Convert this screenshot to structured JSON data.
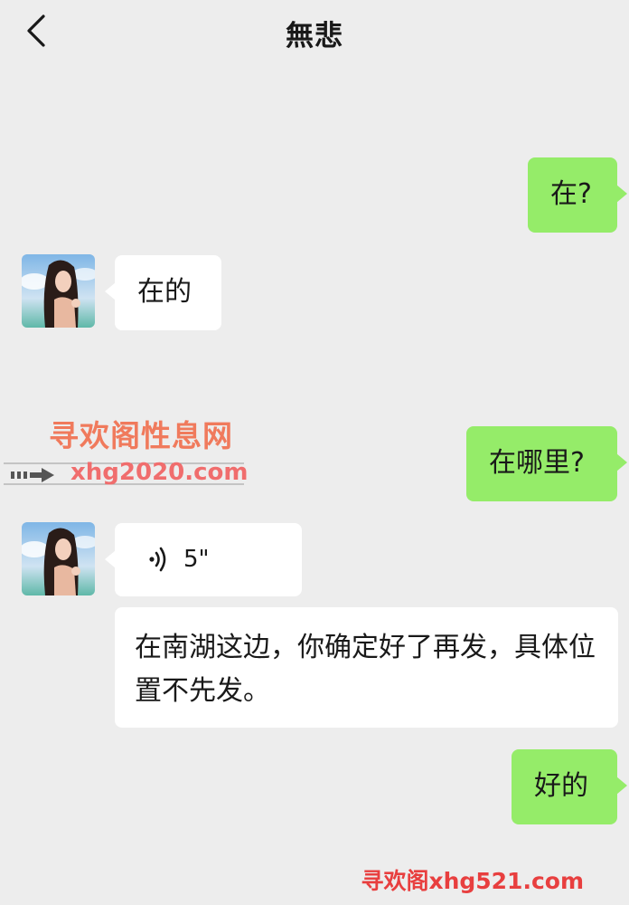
{
  "header": {
    "title": "無悲",
    "back_icon": "chevron-left-icon"
  },
  "messages": [
    {
      "side": "right",
      "text": "在?"
    },
    {
      "side": "left",
      "text": "在的"
    },
    {
      "side": "right",
      "text": "在哪里?"
    },
    {
      "side": "left",
      "type": "voice",
      "duration": "5\""
    },
    {
      "side": "left",
      "text": "在南湖这边，你确定好了再发，具体位置不先发。"
    },
    {
      "side": "right",
      "text": "好的"
    }
  ],
  "watermark": {
    "site_name": "寻欢阁性息网",
    "site_url": "xhg2020.com",
    "bottom_text": "寻欢阁xhg521.com"
  },
  "colors": {
    "background": "#ededed",
    "bubble_right": "#95ec69",
    "bubble_left": "#ffffff"
  }
}
